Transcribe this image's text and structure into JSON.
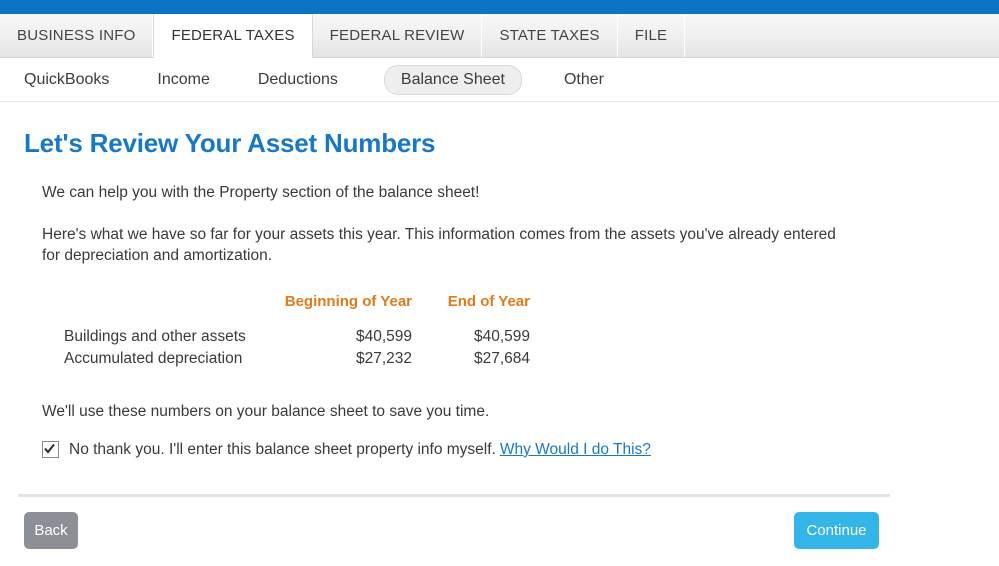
{
  "window": {
    "accent_blue": "#0b72c4",
    "heading_blue": "#1878c8",
    "orange": "#e07b1a",
    "continue_blue": "#33b5e8",
    "back_gray": "#8c9096"
  },
  "main_tabs": [
    {
      "label": "BUSINESS INFO",
      "active": false
    },
    {
      "label": "FEDERAL TAXES",
      "active": true
    },
    {
      "label": "FEDERAL REVIEW",
      "active": false
    },
    {
      "label": "STATE TAXES",
      "active": false
    },
    {
      "label": "FILE",
      "active": false
    }
  ],
  "sub_nav": [
    {
      "label": "QuickBooks",
      "active": false
    },
    {
      "label": "Income",
      "active": false
    },
    {
      "label": "Deductions",
      "active": false
    },
    {
      "label": "Balance Sheet",
      "active": true
    },
    {
      "label": "Other",
      "active": false
    }
  ],
  "main": {
    "title": "Let's Review Your Asset Numbers",
    "intro": "We can help you with the Property section of the balance sheet!",
    "description": "Here's what we have so far for your assets this year. This information comes from the assets you've already entered for depreciation and amortization.",
    "closing": "We'll use these numbers on your balance sheet to save you time."
  },
  "asset_table": {
    "headers": {
      "label": "",
      "beginning_of_year": "Beginning of Year",
      "end_of_year": "End of Year"
    },
    "rows": [
      {
        "label": "Buildings and other assets",
        "beginning_of_year": "$40,599",
        "end_of_year": "$40,599"
      },
      {
        "label": "Accumulated depreciation",
        "beginning_of_year": "$27,232",
        "end_of_year": "$27,684"
      }
    ]
  },
  "opt_out": {
    "checked": true,
    "label": "No thank you. I'll enter this balance sheet property info myself.",
    "link_text": "Why Would I do This?"
  },
  "footer": {
    "back_label": "Back",
    "continue_label": "Continue"
  }
}
